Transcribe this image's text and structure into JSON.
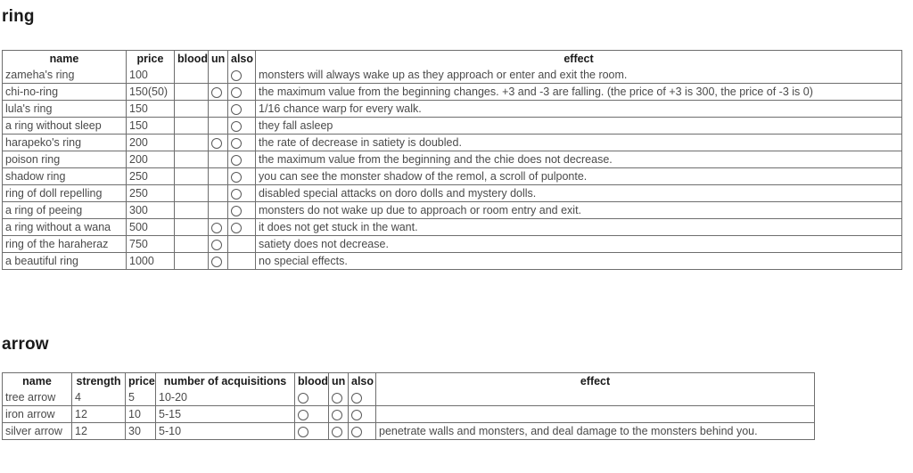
{
  "sections": [
    {
      "title": "ring",
      "table": {
        "headers": [
          "name",
          "price",
          "blood",
          "un",
          "also",
          "effect"
        ],
        "rows": [
          {
            "name": "zameha's ring",
            "price": "100",
            "blood": "",
            "un": "",
            "also": "circle",
            "effect": "monsters will always wake up as they approach or enter and exit the room."
          },
          {
            "name": "chi-no-ring",
            "price": "150(50)",
            "blood": "",
            "un": "circle",
            "also": "circle",
            "effect": "the maximum value from the beginning changes. +3 and -3 are falling. (the price of +3 is 300, the price of -3 is 0)"
          },
          {
            "name": "lula's ring",
            "price": "150",
            "blood": "",
            "un": "",
            "also": "circle",
            "effect": "1/16 chance warp for every walk."
          },
          {
            "name": "a ring without sleep",
            "price": "150",
            "blood": "",
            "un": "",
            "also": "circle",
            "effect": "they fall asleep"
          },
          {
            "name": "harapeko's ring",
            "price": "200",
            "blood": "",
            "un": "circle",
            "also": "circle",
            "effect": "the rate of decrease in satiety is doubled."
          },
          {
            "name": "poison ring",
            "price": "200",
            "blood": "",
            "un": "",
            "also": "circle",
            "effect": "the maximum value from the beginning and the chie does not decrease."
          },
          {
            "name": "shadow ring",
            "price": "250",
            "blood": "",
            "un": "",
            "also": "circle",
            "effect": "you can see the monster shadow of the remol, a scroll of pulponte."
          },
          {
            "name": "ring of doll repelling",
            "price": "250",
            "blood": "",
            "un": "",
            "also": "circle",
            "effect": "disabled special attacks on doro dolls and mystery dolls."
          },
          {
            "name": "a ring of peeing",
            "price": "300",
            "blood": "",
            "un": "",
            "also": "circle",
            "effect": "monsters do not wake up due to approach or room entry and exit."
          },
          {
            "name": "a ring without a wana",
            "price": "500",
            "blood": "",
            "un": "circle",
            "also": "circle",
            "effect": "it does not get stuck in the want."
          },
          {
            "name": "ring of the haraheraz",
            "price": "750",
            "blood": "",
            "un": "circle",
            "also": "",
            "effect": "satiety does not decrease."
          },
          {
            "name": "a beautiful ring",
            "price": "1000",
            "blood": "",
            "un": "circle",
            "also": "",
            "effect": "no special effects."
          }
        ]
      }
    },
    {
      "title": "arrow",
      "table": {
        "headers": [
          "name",
          "strength",
          "price",
          "number of acquisitions",
          "blood",
          "un",
          "also",
          "effect"
        ],
        "rows": [
          {
            "name": "tree arrow",
            "strength": "4",
            "price": "5",
            "acquisitions": "10-20",
            "blood": "circle",
            "un": "circle",
            "also": "circle",
            "effect": ""
          },
          {
            "name": "iron arrow",
            "strength": "12",
            "price": "10",
            "acquisitions": "5-15",
            "blood": "circle",
            "un": "circle",
            "also": "circle",
            "effect": ""
          },
          {
            "name": "silver arrow",
            "strength": "12",
            "price": "30",
            "acquisitions": "5-10",
            "blood": "circle",
            "un": "circle",
            "also": "circle",
            "effect": "penetrate walls and monsters, and deal damage to the monsters behind you."
          }
        ]
      }
    }
  ],
  "icons": {
    "circle": "circle-marker-icon"
  },
  "colors": {
    "border": "#6e6e6e",
    "text": "#4a4a4a",
    "heading": "#1a1a1a",
    "background": "#ffffff"
  }
}
